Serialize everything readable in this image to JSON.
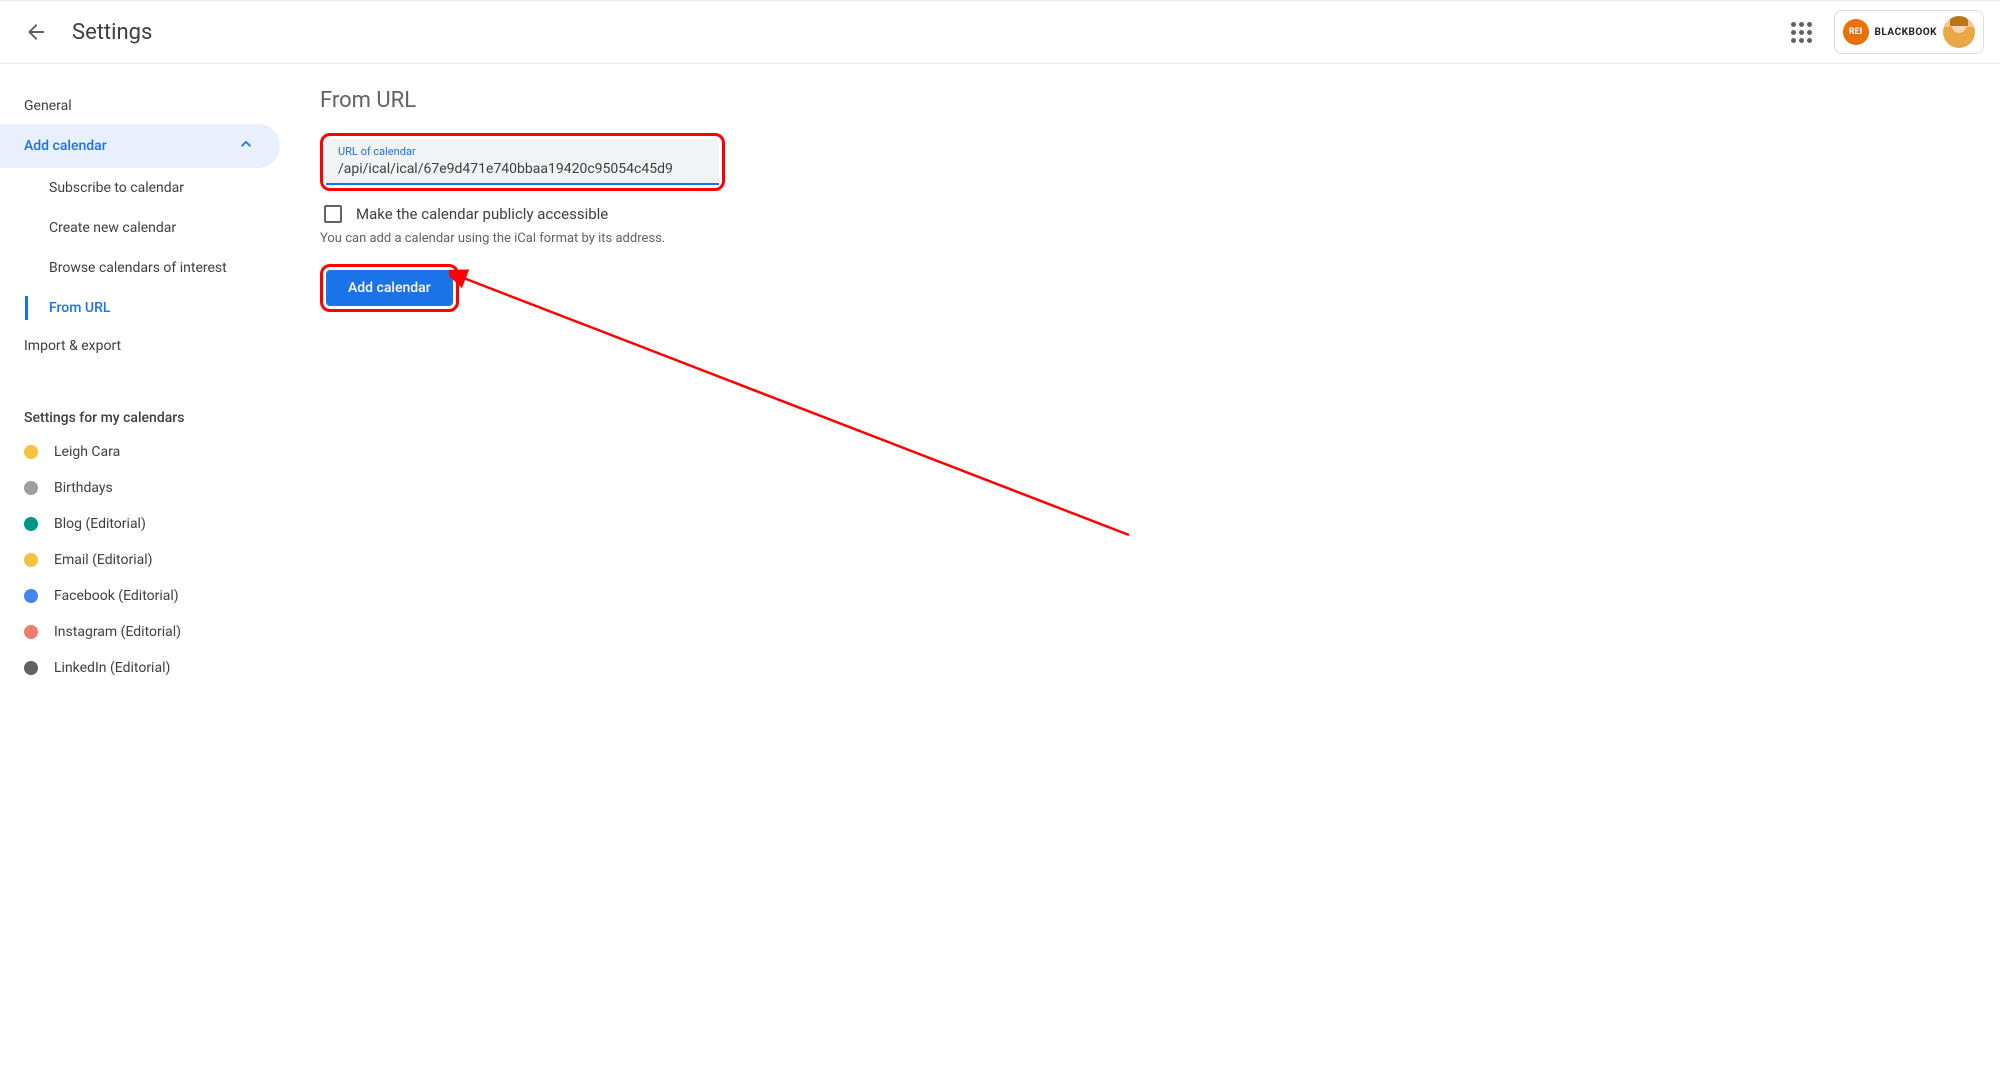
{
  "header": {
    "title": "Settings",
    "brand": {
      "logo_text": "REI",
      "name": "BLACKBOOK"
    }
  },
  "sidebar": {
    "general": "General",
    "add_calendar": "Add calendar",
    "sub_items": [
      "Subscribe to calendar",
      "Create new calendar",
      "Browse calendars of interest",
      "From URL"
    ],
    "import_export": "Import & export",
    "calendars_header": "Settings for my calendars",
    "calendars": [
      {
        "name": "Leigh Cara",
        "color": "#f5c242"
      },
      {
        "name": "Birthdays",
        "color": "#9e9e9e"
      },
      {
        "name": "Blog (Editorial)",
        "color": "#009688"
      },
      {
        "name": "Email (Editorial)",
        "color": "#f5c242"
      },
      {
        "name": "Facebook (Editorial)",
        "color": "#4285f4"
      },
      {
        "name": "Instagram (Editorial)",
        "color": "#ef7d6e"
      },
      {
        "name": "LinkedIn (Editorial)",
        "color": "#616161"
      }
    ]
  },
  "main": {
    "title": "From URL",
    "url_label": "URL of calendar",
    "url_value": "/api/ical/ical/67e9d471e740bbaa19420c95054c45d9",
    "checkbox_label": "Make the calendar publicly accessible",
    "help_text": "You can add a calendar using the iCal format by its address.",
    "add_button": "Add calendar"
  }
}
